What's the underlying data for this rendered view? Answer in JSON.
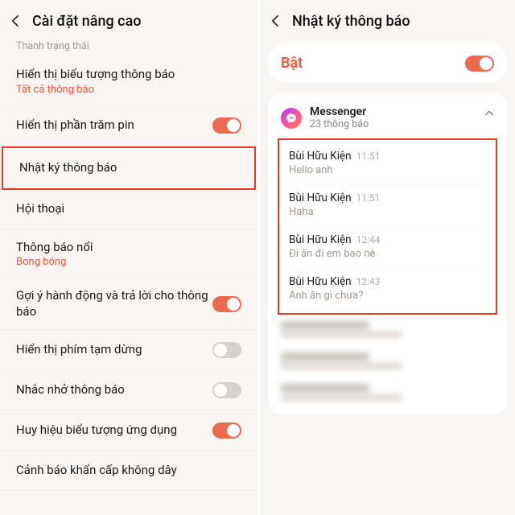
{
  "left": {
    "title": "Cài đặt nâng cao",
    "section_label": "Thanh trạng thái",
    "rows": [
      {
        "title": "Hiển thị biểu tượng thông báo",
        "sub": "Tất cả thông báo",
        "toggle": null
      },
      {
        "title": "Hiển thị phần trăm pin",
        "sub": "",
        "toggle": true
      },
      {
        "title": "Nhật ký thông báo",
        "sub": "",
        "toggle": null,
        "highlight": true
      },
      {
        "title": "Hội thoại",
        "sub": "",
        "toggle": null
      },
      {
        "title": "Thông báo nổi",
        "sub": "Bong bóng",
        "toggle": null
      },
      {
        "title": "Gợi ý hành động và trả lời cho thông báo",
        "sub": "",
        "toggle": true
      },
      {
        "title": "Hiển thị phím tạm dừng",
        "sub": "",
        "toggle": false
      },
      {
        "title": "Nhắc nhở thông báo",
        "sub": "",
        "toggle": false
      },
      {
        "title": "Huy hiệu biểu tượng ứng dụng",
        "sub": "",
        "toggle": true
      },
      {
        "title": "Cảnh báo khẩn cấp không dây",
        "sub": "",
        "toggle": null
      }
    ]
  },
  "right": {
    "title": "Nhật ký thông báo",
    "on_label": "Bật",
    "on_state": true,
    "app": {
      "name": "Messenger",
      "count": "23 thông báo"
    },
    "notifs": [
      {
        "sender": "Bùi Hữu Kiện",
        "time": "11:51",
        "body": "Hello anh"
      },
      {
        "sender": "Bùi Hữu Kiện",
        "time": "11:51",
        "body": "Haha"
      },
      {
        "sender": "Bùi Hữu Kiện",
        "time": "12:44",
        "body": "Đi ăn đi em bao nè"
      },
      {
        "sender": "Bùi Hữu Kiện",
        "time": "12:43",
        "body": "Anh ăn gì chưa?"
      }
    ]
  }
}
